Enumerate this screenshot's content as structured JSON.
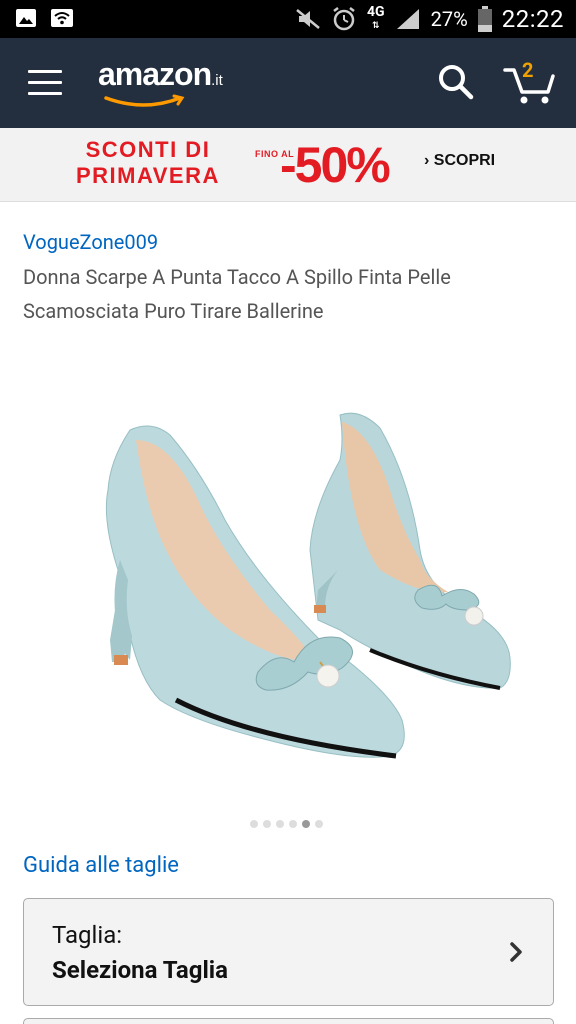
{
  "status_bar": {
    "network": "4G",
    "battery": "27%",
    "time": "22:22"
  },
  "header": {
    "logo": "amazon",
    "logo_tld": ".it",
    "cart_count": "2"
  },
  "promo": {
    "title_line1": "SCONTI DI",
    "title_line2": "PRIMAVERA",
    "fino": "FINO AL",
    "discount": "-50%",
    "cta": "› SCOPRI"
  },
  "product": {
    "brand": "VogueZone009",
    "title_line1": "Donna Scarpe A Punta Tacco A Spillo Finta Pelle",
    "title_line2": "Scamosciata Puro Tirare Ballerine",
    "image_count": 6,
    "active_image": 5
  },
  "size_guide": "Guida alle taglie",
  "size_select": {
    "label": "Taglia:",
    "value": "Seleziona Taglia"
  },
  "colors": {
    "header_bg": "#232f3e",
    "link": "#0066c0",
    "promo_red": "#e31b23",
    "cart_badge": "#f0a100"
  }
}
